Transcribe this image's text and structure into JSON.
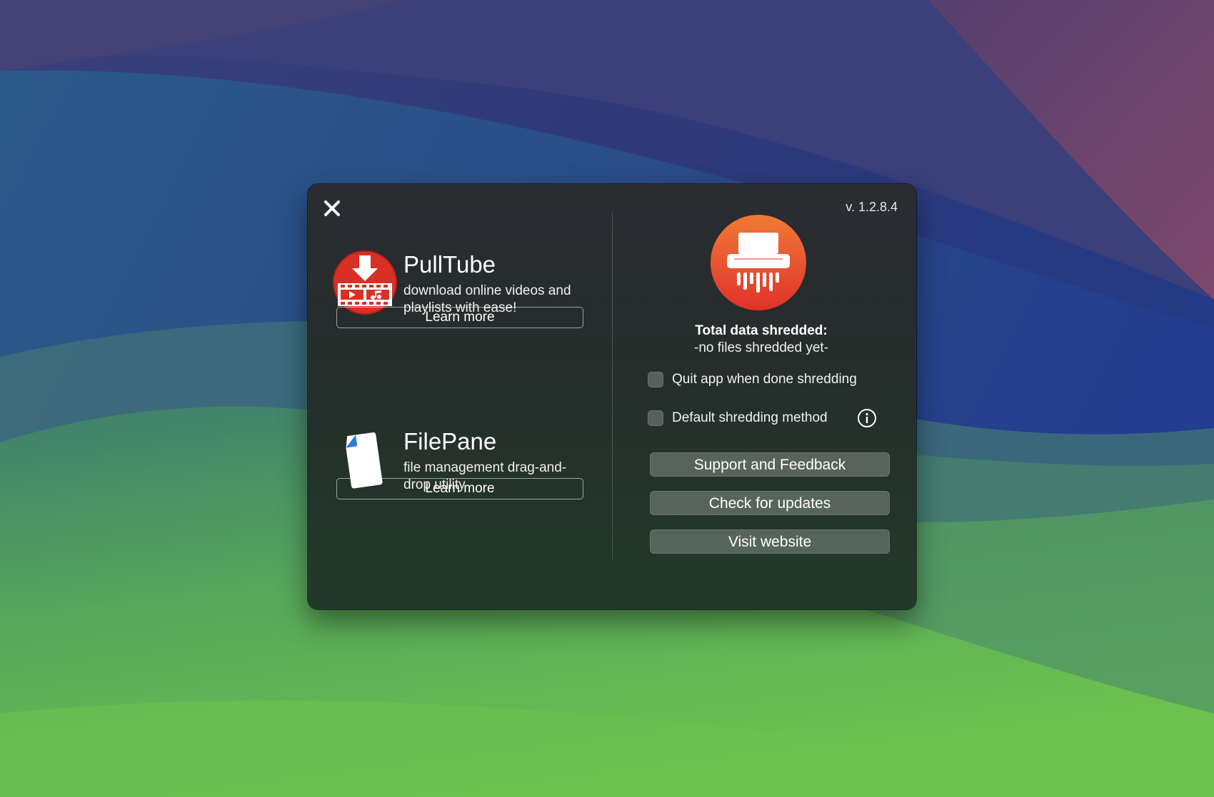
{
  "dialog": {
    "version": "v. 1.2.8.4"
  },
  "promos": [
    {
      "title": "PullTube",
      "description": "download online videos and playlists with ease!",
      "button_label": "Learn more"
    },
    {
      "title": "FilePane",
      "description": "file management drag-and-drop utility",
      "button_label": "Learn more"
    }
  ],
  "stats": {
    "label": "Total data shredded:",
    "value": "-no files shredded yet-"
  },
  "options": {
    "quit_when_done": {
      "label": "Quit app when done shredding",
      "checked": false
    },
    "default_method": {
      "label": "Default shredding method",
      "checked": false
    }
  },
  "actions": {
    "support": "Support and Feedback",
    "updates": "Check for updates",
    "website": "Visit website"
  },
  "icons": {
    "close": "close-icon",
    "info": "info-icon",
    "pulltube_logo": "pulltube-logo-icon",
    "filepane_logo": "filepane-document-icon",
    "shredder_logo": "shredder-app-icon"
  },
  "colors": {
    "panel_background": "#262b2c",
    "shredder_red": "#e8402e",
    "pulltube_red": "#d93025",
    "button_fill": "#6b7670"
  }
}
